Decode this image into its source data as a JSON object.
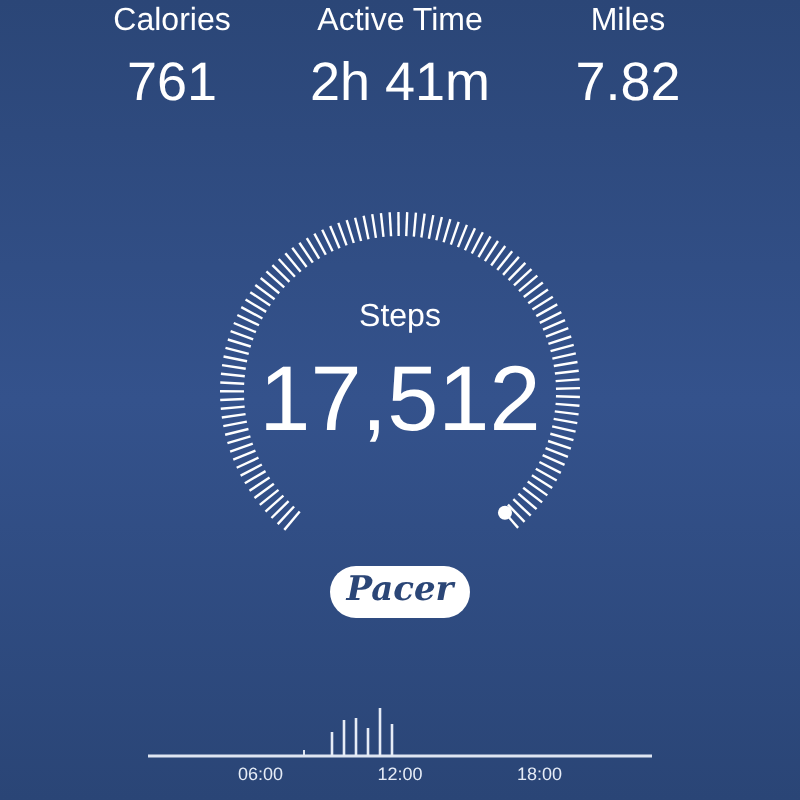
{
  "stats": [
    {
      "label": "Calories",
      "value": "761"
    },
    {
      "label": "Active Time",
      "value": "2h 41m"
    },
    {
      "label": "Miles",
      "value": "7.82"
    }
  ],
  "gauge": {
    "label": "Steps",
    "value": "17,512"
  },
  "badge": "Pacer",
  "timeline": {
    "hours": [
      "06:00",
      "12:00",
      "18:00"
    ]
  }
}
